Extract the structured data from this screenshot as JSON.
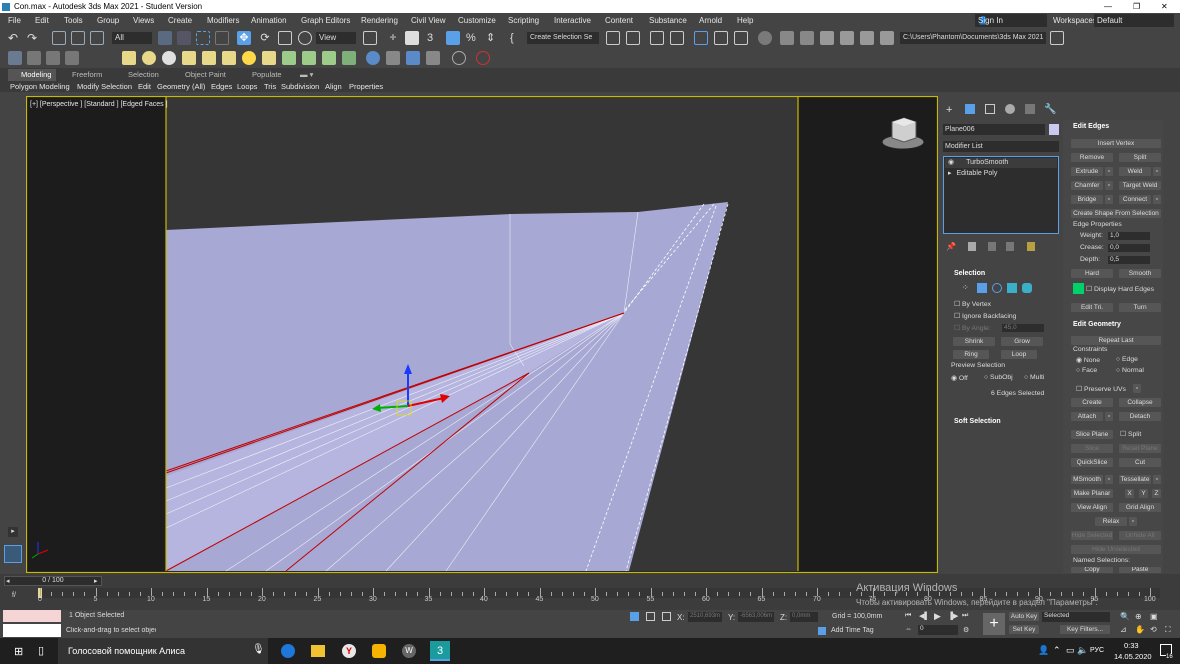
{
  "titlebar": {
    "text": "Con.max - Autodesk 3ds Max 2021 - Student Version"
  },
  "menu": [
    "File",
    "Edit",
    "Tools",
    "Group",
    "Views",
    "Create",
    "Modifiers",
    "Animation",
    "Graph Editors",
    "Rendering",
    "Civil View",
    "Customize",
    "Scripting",
    "Interactive",
    "Content",
    "Substance",
    "Arnold",
    "Help"
  ],
  "account": {
    "signin": "Sign In",
    "workspaces_label": "Workspaces:",
    "workspace": "Default"
  },
  "toolbar": {
    "filter": "All",
    "refcoord": "View",
    "selset": "Create Selection Se",
    "path": "C:\\Users\\Phantom\\Documents\\3ds Max 2021"
  },
  "ribbon": {
    "tabs": [
      "Modeling",
      "Freeform",
      "Selection",
      "Object Paint",
      "Populate"
    ],
    "buttons": [
      "Polygon Modeling",
      "Modify Selection",
      "Edit",
      "Geometry (All)",
      "Edges",
      "Loops",
      "Tris",
      "Subdivision",
      "Align",
      "Properties"
    ]
  },
  "viewport": {
    "label": "[+] [Perspective ] [Standard ] [Edged Faces ]"
  },
  "cmd": {
    "object_name": "Plane006",
    "modifier_list": "Modifier List",
    "stack": [
      "TurboSmooth",
      "Editable Poly"
    ],
    "selection": {
      "header": "Selection",
      "by_vertex": "By Vertex",
      "ignore_backfacing": "Ignore Backfacing",
      "by_angle": "By Angle:",
      "angle": "45,0",
      "shrink": "Shrink",
      "grow": "Grow",
      "ring": "Ring",
      "loop": "Loop",
      "preview": "Preview Selection",
      "off": "Off",
      "subobj": "SubObj",
      "multi": "Multi",
      "status": "6 Edges Selected"
    },
    "soft_selection": "Soft Selection",
    "edit_edges": {
      "header": "Edit Edges",
      "insert_vertex": "Insert Vertex",
      "remove": "Remove",
      "split": "Split",
      "extrude": "Extrude",
      "weld": "Weld",
      "chamfer": "Chamfer",
      "target_weld": "Target Weld",
      "bridge": "Bridge",
      "connect": "Connect",
      "create_shape": "Create Shape From Selection",
      "edge_props": "Edge Properties",
      "weight_label": "Weight:",
      "weight": "1,0",
      "crease_label": "Crease:",
      "crease": "0,0",
      "depth_label": "Depth:",
      "depth": "0,5",
      "hard": "Hard",
      "smooth": "Smooth",
      "display_hard": "Display Hard Edges",
      "edit_tri": "Edit Tri.",
      "turn": "Turn"
    },
    "edit_geometry": {
      "header": "Edit Geometry",
      "repeat_last": "Repeat Last",
      "constraints": "Constraints",
      "none": "None",
      "edge": "Edge",
      "face": "Face",
      "normal": "Normal",
      "preserve_uvs": "Preserve UVs",
      "create": "Create",
      "collapse": "Collapse",
      "attach": "Attach",
      "detach": "Detach",
      "slice_plane": "Slice Plane",
      "split": "Split",
      "slice": "Slice",
      "reset_plane": "Reset Plane",
      "quickslice": "QuickSlice",
      "cut": "Cut",
      "msmooth": "MSmooth",
      "tessellate": "Tessellate",
      "make_planar": "Make Planar",
      "x": "X",
      "y": "Y",
      "z": "Z",
      "view_align": "View Align",
      "grid_align": "Grid Align",
      "relax": "Relax",
      "hide_selected": "Hide Selected",
      "unhide_all": "Unhide All",
      "hide_unselected": "Hide Unselected",
      "named_selections": "Named Selections:",
      "copy": "Copy",
      "paste": "Paste"
    }
  },
  "timeline": {
    "frame": "0 / 100",
    "ticks": [
      "0",
      "5",
      "10",
      "15",
      "20",
      "25",
      "30",
      "35",
      "40",
      "45",
      "50",
      "55",
      "60",
      "65",
      "70",
      "75",
      "80",
      "85",
      "90",
      "95",
      "100"
    ]
  },
  "status": {
    "selected": "1 Object Selected",
    "prompt": "Click-and-drag to select objects",
    "x_label": "X:",
    "x": "2510,693m",
    "y_label": "Y:",
    "y": "-6563,006m",
    "z_label": "Z:",
    "z": "0,0mm",
    "grid": "Grid = 100,0mm",
    "add_time_tag": "Add Time Tag",
    "auto_key": "Auto Key",
    "set_key": "Set Key",
    "selected_dd": "Selected",
    "key_filters": "Key Filters...",
    "frame_field": "0"
  },
  "watermark": {
    "line1": "Активация Windows",
    "line2": "Чтобы активировать Windows, перейдите в раздел \"Параметры\"."
  },
  "taskbar": {
    "search": "Голосовой помощник Алиса",
    "time": "0:33",
    "date": "14.05.2020",
    "lang": "РУС",
    "notif": "16"
  },
  "colors": {
    "accent": "#5aa0e8",
    "viewport_border": "#c8b800",
    "mesh": "#a8a8d4",
    "selected_edge": "#c00000",
    "display_hard_swatch": "#00d26a"
  }
}
